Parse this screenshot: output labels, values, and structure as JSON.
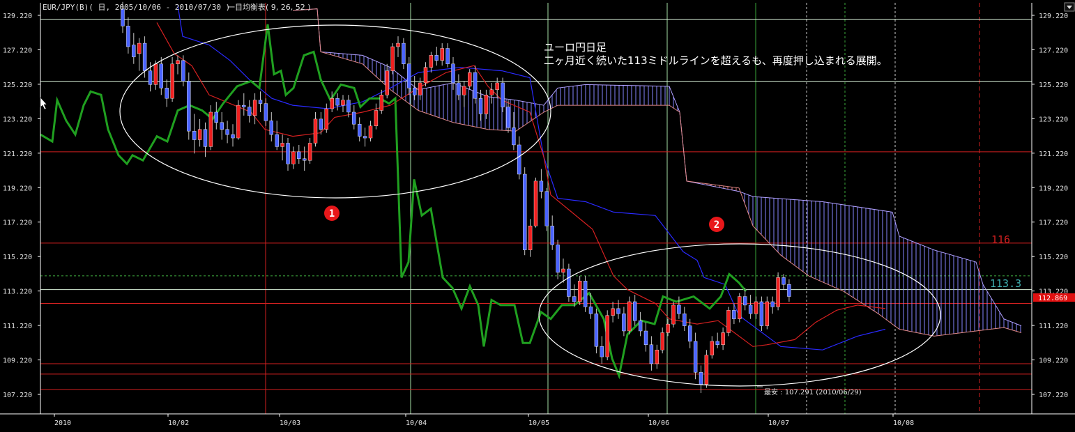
{
  "chart_data": {
    "type": "candlestick",
    "header": "EUR/JPY(B)( 日, 2005/10/06 - 2010/07/30 )",
    "indicator_label": "一目均衡表( 9, 26, 52 )",
    "annotation_title": "ユーロ円日足",
    "annotation_text": "二ヶ月近く続いた113ミドルラインを超えるも、再度押し込まれる展開。",
    "low_note": "最安 : 107.291 (2010/06/29)",
    "circle_labels": [
      "1",
      "2"
    ],
    "current_price": "112.869",
    "level_labels": [
      {
        "label": "116",
        "value": 116.0
      },
      {
        "label": "113.3",
        "value": 113.3
      }
    ],
    "ylim": [
      106.5,
      130.0
    ],
    "y_ticks": [
      129.22,
      127.22,
      125.22,
      123.22,
      121.22,
      119.22,
      117.22,
      115.22,
      113.22,
      111.22,
      109.22,
      107.22
    ],
    "x_ticks": [
      "2010",
      "10/02",
      "10/03",
      "10/04",
      "10/05",
      "10/06",
      "10/07",
      "10/08"
    ],
    "horizontal_lines": {
      "red": [
        121.3,
        116.0,
        112.5,
        109.0,
        108.4,
        107.5
      ],
      "white": [
        129.0,
        125.4,
        113.3
      ],
      "dashed_green": [
        114.1
      ]
    },
    "candles": [
      {
        "o": 129.6,
        "h": 130.0,
        "l": 128.2,
        "c": 128.6
      },
      {
        "o": 128.6,
        "h": 129.1,
        "l": 127.0,
        "c": 127.4
      },
      {
        "o": 127.5,
        "h": 128.2,
        "l": 126.4,
        "c": 126.8
      },
      {
        "o": 127.0,
        "h": 127.9,
        "l": 126.0,
        "c": 127.6
      },
      {
        "o": 127.6,
        "h": 128.0,
        "l": 125.6,
        "c": 126.0
      },
      {
        "o": 126.0,
        "h": 126.5,
        "l": 124.8,
        "c": 125.2
      },
      {
        "o": 125.2,
        "h": 126.6,
        "l": 124.9,
        "c": 126.4
      },
      {
        "o": 126.4,
        "h": 126.8,
        "l": 124.6,
        "c": 125.0
      },
      {
        "o": 125.0,
        "h": 125.5,
        "l": 123.9,
        "c": 124.4
      },
      {
        "o": 124.4,
        "h": 126.8,
        "l": 124.2,
        "c": 126.4
      },
      {
        "o": 126.4,
        "h": 126.9,
        "l": 125.8,
        "c": 126.6
      },
      {
        "o": 126.6,
        "h": 126.9,
        "l": 125.1,
        "c": 125.4
      },
      {
        "o": 125.4,
        "h": 125.9,
        "l": 122.0,
        "c": 122.5
      },
      {
        "o": 122.5,
        "h": 123.5,
        "l": 121.2,
        "c": 122.0
      },
      {
        "o": 122.0,
        "h": 123.2,
        "l": 121.6,
        "c": 122.6
      },
      {
        "o": 122.6,
        "h": 123.0,
        "l": 121.0,
        "c": 121.6
      },
      {
        "o": 121.6,
        "h": 124.0,
        "l": 121.4,
        "c": 123.6
      },
      {
        "o": 123.6,
        "h": 124.2,
        "l": 122.6,
        "c": 123.0
      },
      {
        "o": 123.0,
        "h": 123.6,
        "l": 122.0,
        "c": 122.6
      },
      {
        "o": 122.6,
        "h": 123.1,
        "l": 121.8,
        "c": 122.3
      },
      {
        "o": 122.3,
        "h": 122.9,
        "l": 121.6,
        "c": 122.1
      },
      {
        "o": 122.1,
        "h": 124.3,
        "l": 122.0,
        "c": 124.0
      },
      {
        "o": 124.0,
        "h": 124.7,
        "l": 123.4,
        "c": 123.9
      },
      {
        "o": 123.9,
        "h": 124.3,
        "l": 123.0,
        "c": 123.4
      },
      {
        "o": 123.4,
        "h": 124.7,
        "l": 122.9,
        "c": 124.3
      },
      {
        "o": 124.3,
        "h": 124.8,
        "l": 123.6,
        "c": 124.1
      },
      {
        "o": 124.1,
        "h": 124.4,
        "l": 122.8,
        "c": 123.1
      },
      {
        "o": 123.1,
        "h": 123.6,
        "l": 121.9,
        "c": 122.3
      },
      {
        "o": 122.3,
        "h": 123.1,
        "l": 121.4,
        "c": 121.6
      },
      {
        "o": 121.6,
        "h": 122.3,
        "l": 120.8,
        "c": 121.8
      },
      {
        "o": 121.8,
        "h": 122.1,
        "l": 120.2,
        "c": 120.6
      },
      {
        "o": 120.6,
        "h": 121.6,
        "l": 120.3,
        "c": 121.3
      },
      {
        "o": 121.3,
        "h": 121.7,
        "l": 120.6,
        "c": 120.9
      },
      {
        "o": 120.9,
        "h": 121.6,
        "l": 120.2,
        "c": 120.8
      },
      {
        "o": 120.8,
        "h": 122.1,
        "l": 120.6,
        "c": 121.8
      },
      {
        "o": 121.8,
        "h": 123.6,
        "l": 121.6,
        "c": 123.2
      },
      {
        "o": 123.2,
        "h": 123.6,
        "l": 122.3,
        "c": 122.6
      },
      {
        "o": 122.6,
        "h": 124.1,
        "l": 122.4,
        "c": 123.8
      },
      {
        "o": 123.8,
        "h": 124.8,
        "l": 123.6,
        "c": 124.4
      },
      {
        "o": 124.4,
        "h": 124.7,
        "l": 123.7,
        "c": 124.0
      },
      {
        "o": 124.0,
        "h": 124.6,
        "l": 123.6,
        "c": 124.3
      },
      {
        "o": 124.3,
        "h": 124.6,
        "l": 123.3,
        "c": 123.6
      },
      {
        "o": 123.6,
        "h": 124.0,
        "l": 122.6,
        "c": 122.9
      },
      {
        "o": 122.9,
        "h": 123.3,
        "l": 121.9,
        "c": 122.2
      },
      {
        "o": 122.2,
        "h": 122.7,
        "l": 121.6,
        "c": 122.1
      },
      {
        "o": 122.1,
        "h": 123.1,
        "l": 121.9,
        "c": 122.8
      },
      {
        "o": 122.8,
        "h": 124.1,
        "l": 122.6,
        "c": 123.7
      },
      {
        "o": 123.7,
        "h": 124.9,
        "l": 123.5,
        "c": 124.6
      },
      {
        "o": 124.6,
        "h": 126.4,
        "l": 124.4,
        "c": 126.0
      },
      {
        "o": 126.0,
        "h": 127.6,
        "l": 125.8,
        "c": 127.4
      },
      {
        "o": 127.4,
        "h": 128.0,
        "l": 126.8,
        "c": 127.6
      },
      {
        "o": 127.6,
        "h": 127.9,
        "l": 126.1,
        "c": 126.4
      },
      {
        "o": 126.4,
        "h": 126.8,
        "l": 124.6,
        "c": 125.0
      },
      {
        "o": 125.0,
        "h": 125.7,
        "l": 124.3,
        "c": 124.6
      },
      {
        "o": 124.6,
        "h": 125.6,
        "l": 124.3,
        "c": 125.3
      },
      {
        "o": 125.3,
        "h": 126.5,
        "l": 125.1,
        "c": 126.2
      },
      {
        "o": 126.2,
        "h": 127.1,
        "l": 125.9,
        "c": 126.9
      },
      {
        "o": 126.9,
        "h": 127.4,
        "l": 126.3,
        "c": 126.6
      },
      {
        "o": 126.6,
        "h": 127.6,
        "l": 126.3,
        "c": 127.3
      },
      {
        "o": 127.3,
        "h": 127.6,
        "l": 126.2,
        "c": 126.4
      },
      {
        "o": 126.4,
        "h": 126.8,
        "l": 124.9,
        "c": 125.3
      },
      {
        "o": 125.3,
        "h": 125.8,
        "l": 124.3,
        "c": 124.6
      },
      {
        "o": 124.6,
        "h": 125.4,
        "l": 123.9,
        "c": 125.1
      },
      {
        "o": 125.1,
        "h": 126.1,
        "l": 124.9,
        "c": 125.9
      },
      {
        "o": 125.9,
        "h": 126.3,
        "l": 124.1,
        "c": 124.4
      },
      {
        "o": 124.4,
        "h": 124.9,
        "l": 123.1,
        "c": 123.5
      },
      {
        "o": 123.5,
        "h": 124.9,
        "l": 123.2,
        "c": 124.6
      },
      {
        "o": 124.6,
        "h": 125.3,
        "l": 124.1,
        "c": 124.9
      },
      {
        "o": 124.9,
        "h": 125.6,
        "l": 124.4,
        "c": 125.3
      },
      {
        "o": 125.3,
        "h": 125.6,
        "l": 123.6,
        "c": 123.9
      },
      {
        "o": 123.9,
        "h": 124.3,
        "l": 122.4,
        "c": 122.7
      },
      {
        "o": 122.7,
        "h": 123.6,
        "l": 121.4,
        "c": 121.7
      },
      {
        "o": 121.7,
        "h": 122.2,
        "l": 119.7,
        "c": 120.0
      },
      {
        "o": 120.0,
        "h": 120.4,
        "l": 115.3,
        "c": 115.6
      },
      {
        "o": 115.6,
        "h": 117.4,
        "l": 115.2,
        "c": 117.0
      },
      {
        "o": 117.0,
        "h": 119.8,
        "l": 116.9,
        "c": 119.6
      },
      {
        "o": 119.6,
        "h": 120.3,
        "l": 118.6,
        "c": 119.0
      },
      {
        "o": 119.0,
        "h": 119.2,
        "l": 116.7,
        "c": 117.0
      },
      {
        "o": 117.0,
        "h": 117.6,
        "l": 115.6,
        "c": 115.9
      },
      {
        "o": 115.9,
        "h": 116.2,
        "l": 113.9,
        "c": 114.3
      },
      {
        "o": 114.3,
        "h": 115.1,
        "l": 113.7,
        "c": 114.5
      },
      {
        "o": 114.5,
        "h": 114.8,
        "l": 112.6,
        "c": 112.9
      },
      {
        "o": 112.9,
        "h": 113.6,
        "l": 112.3,
        "c": 112.6
      },
      {
        "o": 112.6,
        "h": 114.1,
        "l": 112.4,
        "c": 113.8
      },
      {
        "o": 113.8,
        "h": 114.1,
        "l": 112.0,
        "c": 112.3
      },
      {
        "o": 112.3,
        "h": 113.1,
        "l": 111.6,
        "c": 111.9
      },
      {
        "o": 111.9,
        "h": 112.2,
        "l": 109.6,
        "c": 110.0
      },
      {
        "o": 110.0,
        "h": 110.6,
        "l": 109.0,
        "c": 109.4
      },
      {
        "o": 109.4,
        "h": 112.1,
        "l": 109.2,
        "c": 111.8
      },
      {
        "o": 111.8,
        "h": 112.6,
        "l": 111.4,
        "c": 112.2
      },
      {
        "o": 112.2,
        "h": 112.7,
        "l": 111.6,
        "c": 111.9
      },
      {
        "o": 111.9,
        "h": 112.3,
        "l": 110.6,
        "c": 110.9
      },
      {
        "o": 110.9,
        "h": 112.9,
        "l": 110.7,
        "c": 112.6
      },
      {
        "o": 112.6,
        "h": 113.0,
        "l": 111.2,
        "c": 111.5
      },
      {
        "o": 111.5,
        "h": 112.0,
        "l": 110.6,
        "c": 110.9
      },
      {
        "o": 110.9,
        "h": 111.4,
        "l": 109.7,
        "c": 110.1
      },
      {
        "o": 110.1,
        "h": 110.6,
        "l": 108.6,
        "c": 109.0
      },
      {
        "o": 109.0,
        "h": 110.1,
        "l": 108.7,
        "c": 109.8
      },
      {
        "o": 109.8,
        "h": 111.1,
        "l": 109.6,
        "c": 110.8
      },
      {
        "o": 110.8,
        "h": 111.6,
        "l": 110.6,
        "c": 111.3
      },
      {
        "o": 111.3,
        "h": 112.6,
        "l": 111.1,
        "c": 112.4
      },
      {
        "o": 112.4,
        "h": 112.9,
        "l": 111.6,
        "c": 111.9
      },
      {
        "o": 111.9,
        "h": 112.3,
        "l": 110.9,
        "c": 111.2
      },
      {
        "o": 111.2,
        "h": 111.6,
        "l": 109.9,
        "c": 110.3
      },
      {
        "o": 110.3,
        "h": 110.8,
        "l": 108.1,
        "c": 108.5
      },
      {
        "o": 108.5,
        "h": 108.9,
        "l": 107.3,
        "c": 107.8
      },
      {
        "o": 107.8,
        "h": 109.8,
        "l": 107.6,
        "c": 109.5
      },
      {
        "o": 109.5,
        "h": 110.6,
        "l": 109.3,
        "c": 110.3
      },
      {
        "o": 110.3,
        "h": 110.8,
        "l": 109.9,
        "c": 110.1
      },
      {
        "o": 110.1,
        "h": 111.1,
        "l": 109.8,
        "c": 110.8
      },
      {
        "o": 110.8,
        "h": 112.3,
        "l": 110.6,
        "c": 112.1
      },
      {
        "o": 112.1,
        "h": 112.5,
        "l": 111.3,
        "c": 111.6
      },
      {
        "o": 111.6,
        "h": 113.1,
        "l": 111.4,
        "c": 112.9
      },
      {
        "o": 112.9,
        "h": 113.4,
        "l": 112.1,
        "c": 112.4
      },
      {
        "o": 112.4,
        "h": 113.0,
        "l": 111.6,
        "c": 111.9
      },
      {
        "o": 111.9,
        "h": 112.9,
        "l": 111.6,
        "c": 112.6
      },
      {
        "o": 112.6,
        "h": 112.9,
        "l": 110.9,
        "c": 111.2
      },
      {
        "o": 111.2,
        "h": 112.9,
        "l": 111.0,
        "c": 112.6
      },
      {
        "o": 112.6,
        "h": 112.9,
        "l": 111.9,
        "c": 112.3
      },
      {
        "o": 112.3,
        "h": 114.3,
        "l": 112.1,
        "c": 114.0
      },
      {
        "o": 114.0,
        "h": 114.2,
        "l": 113.3,
        "c": 113.6
      },
      {
        "o": 113.6,
        "h": 113.9,
        "l": 112.6,
        "c": 112.9
      }
    ]
  }
}
